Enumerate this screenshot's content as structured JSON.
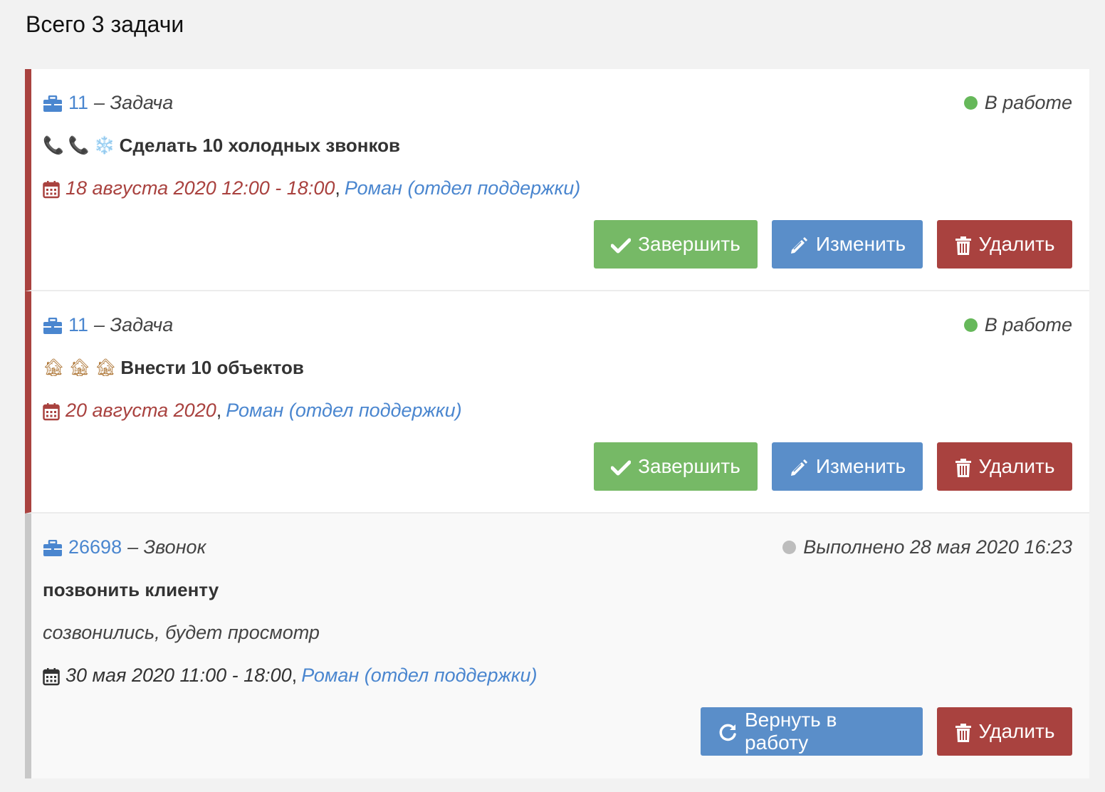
{
  "page": {
    "title": "Всего 3 задачи"
  },
  "tasks": [
    {
      "id": "11",
      "type": "– Задача",
      "status": "В работе",
      "icons": [
        "📞",
        "📞",
        "❄️"
      ],
      "title": "Сделать 10 холодных звонков",
      "date": "18 августа 2020 12:00 - 18:00",
      "separator": ",",
      "user": "Роман (отдел поддержки)",
      "buttons": {
        "complete": "Завершить",
        "edit": "Изменить",
        "delete": "Удалить"
      }
    },
    {
      "id": "11",
      "type": "– Задача",
      "status": "В работе",
      "icons": [
        "🏚",
        "🏚",
        "🏚"
      ],
      "title": "Внести 10 объектов",
      "date": "20 августа 2020",
      "separator": ",",
      "user": "Роман (отдел поддержки)",
      "buttons": {
        "complete": "Завершить",
        "edit": "Изменить",
        "delete": "Удалить"
      }
    },
    {
      "id": "26698",
      "type": "– Звонок",
      "status": "Выполнено 28 мая 2020 16:23",
      "title": "позвонить клиенту",
      "comment": "созвонились, будет просмотр",
      "date": "30 мая 2020 11:00 - 18:00",
      "separator": ",",
      "user": "Роман (отдел поддержки)",
      "buttons": {
        "reopen": "Вернуть в работу",
        "delete": "Удалить"
      }
    }
  ],
  "colors": {
    "active_border": "#a9423f",
    "done_border": "#c8c8c8",
    "link": "#4a86cf",
    "success": "#76b966",
    "primary": "#5a8ec9",
    "danger": "#a9423f",
    "status_active": "#66b85a",
    "status_done": "#bdbdbd"
  },
  "icon_names": {
    "type": "briefcase-icon",
    "date": "calendar-icon",
    "complete": "check-icon",
    "edit": "pencil-icon",
    "delete": "trash-icon",
    "reopen": "refresh-icon"
  }
}
